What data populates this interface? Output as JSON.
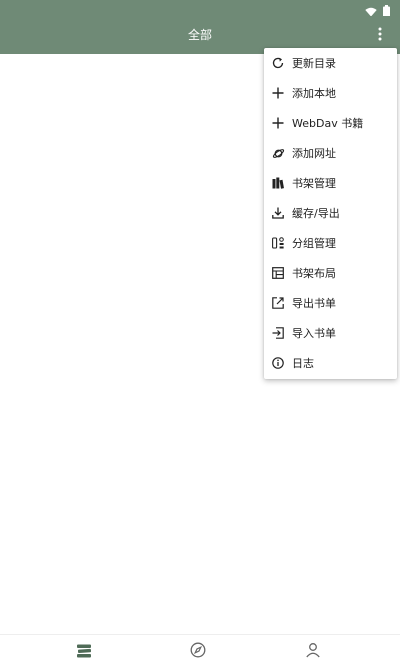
{
  "app": {
    "accent": "#6f8a76",
    "toolbar_title": "全部"
  },
  "status_bar": {
    "icons": [
      "wifi-icon",
      "battery-icon"
    ]
  },
  "menu": {
    "items": [
      {
        "label": "更新目录",
        "icon": "refresh-icon"
      },
      {
        "label": "添加本地",
        "icon": "plus-icon"
      },
      {
        "label": "WebDav 书籍",
        "icon": "plus-icon"
      },
      {
        "label": "添加网址",
        "icon": "planet-icon"
      },
      {
        "label": "书架管理",
        "icon": "bookshelf-icon"
      },
      {
        "label": "缓存/导出",
        "icon": "download-icon"
      },
      {
        "label": "分组管理",
        "icon": "group-icon"
      },
      {
        "label": "书架布局",
        "icon": "layout-icon"
      },
      {
        "label": "导出书单",
        "icon": "export-icon"
      },
      {
        "label": "导入书单",
        "icon": "import-icon"
      },
      {
        "label": "日志",
        "icon": "info-icon"
      }
    ]
  },
  "bottom_nav": {
    "items": [
      {
        "name": "bookshelf",
        "icon": "bookshelf-tab-icon",
        "active": true
      },
      {
        "name": "explore",
        "icon": "compass-icon",
        "active": false
      },
      {
        "name": "profile",
        "icon": "person-icon",
        "active": false
      }
    ]
  }
}
